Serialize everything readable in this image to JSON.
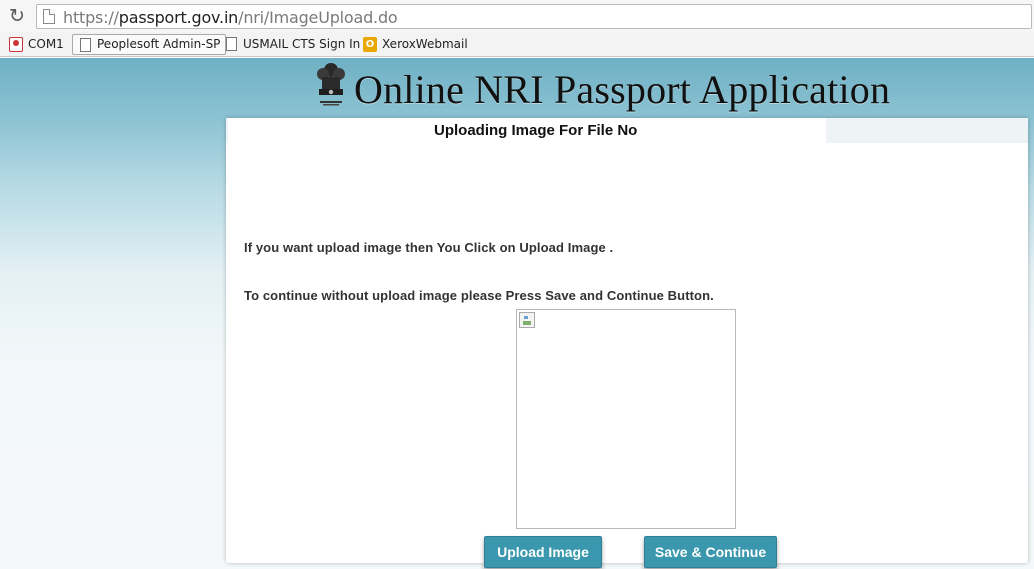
{
  "browser": {
    "reload_icon": "reload-icon",
    "url_scheme": "https://",
    "url_host": "passport.gov.in",
    "url_path": "/nri/ImageUpload.do",
    "bookmarks": [
      {
        "label": "COM1",
        "icon": "emblem-icon"
      },
      {
        "label": "Peoplesoft Admin-SP",
        "icon": "page-icon"
      },
      {
        "label": "USMAIL CTS Sign In",
        "icon": "page-icon"
      },
      {
        "label": "XeroxWebmail",
        "icon": "xerox-icon"
      }
    ]
  },
  "header": {
    "title": "Online NRI Passport Application",
    "emblem_icon": "national-emblem-icon"
  },
  "panel": {
    "title": "Uploading Image For File No",
    "instruction_1": "If you want upload image then You Click on Upload Image .",
    "instruction_2": "To continue without upload image please Press Save and Continue Button."
  },
  "buttons": {
    "upload_label": "Upload Image",
    "save_label": "Save & Continue"
  },
  "colors": {
    "button": "#3a97ad",
    "background_top": "#6fb0c4",
    "background_bottom": "#f4f8f9"
  }
}
